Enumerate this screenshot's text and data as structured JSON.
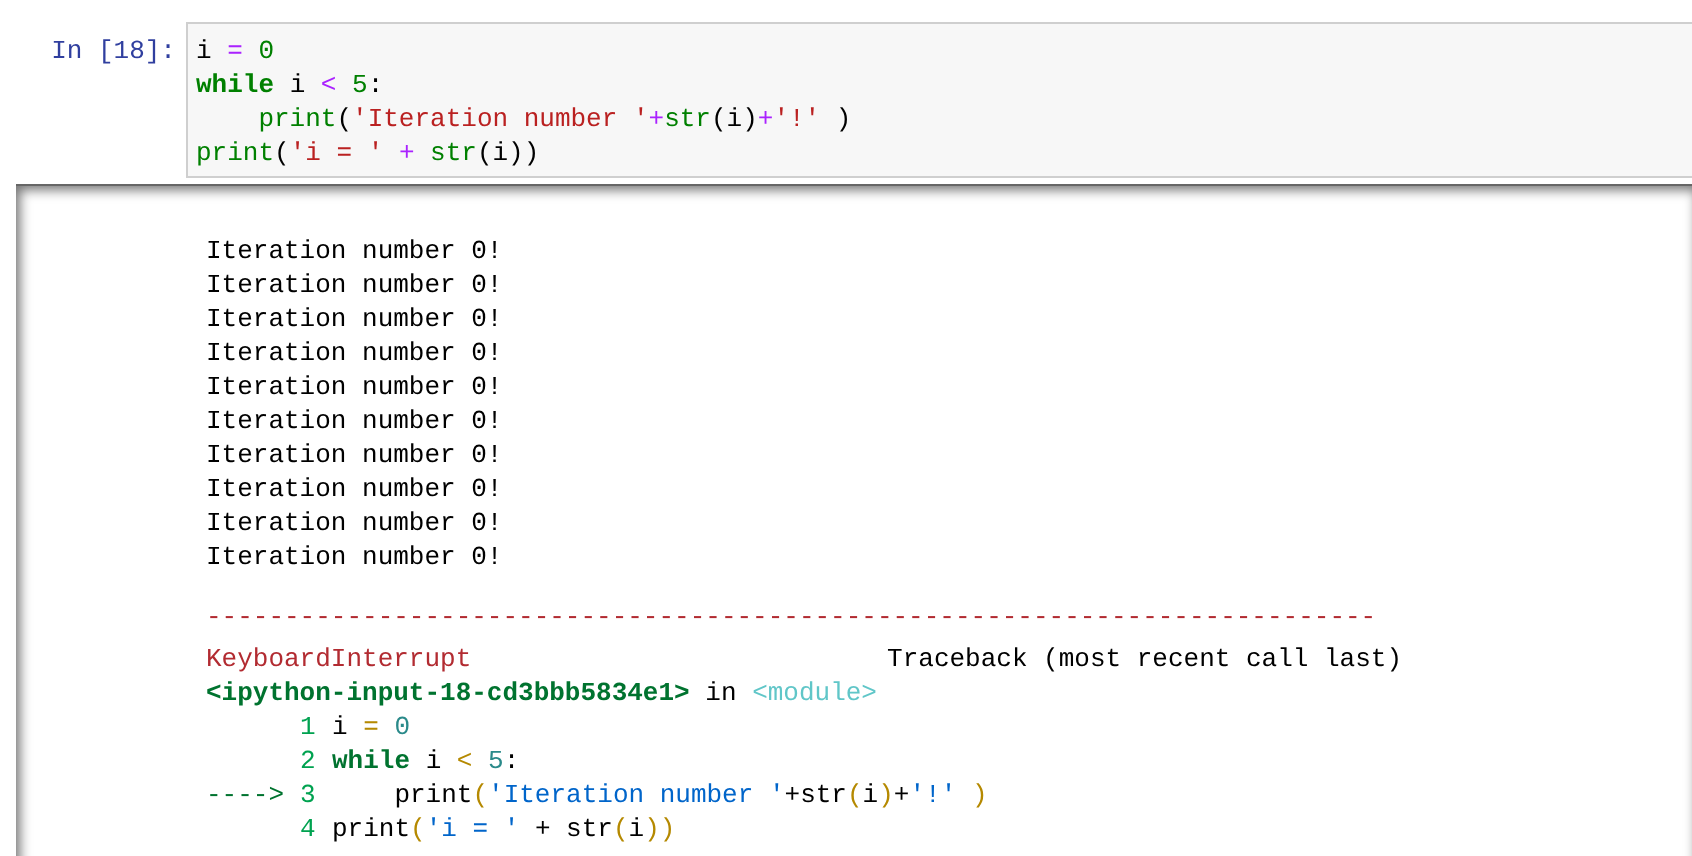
{
  "cell": {
    "prompt": "In [18]:",
    "code": [
      [
        {
          "kind": "name",
          "text": "i "
        },
        {
          "kind": "op",
          "text": "= "
        },
        {
          "kind": "number",
          "text": "0"
        }
      ],
      [
        {
          "kind": "keyword",
          "text": "while"
        },
        {
          "kind": "name",
          "text": " i "
        },
        {
          "kind": "op",
          "text": "< "
        },
        {
          "kind": "number",
          "text": "5"
        },
        {
          "kind": "name",
          "text": ":"
        }
      ],
      [
        {
          "kind": "builtin",
          "text": "    print"
        },
        {
          "kind": "name",
          "text": "("
        },
        {
          "kind": "string",
          "text": "'Iteration number '"
        },
        {
          "kind": "op",
          "text": "+"
        },
        {
          "kind": "builtin",
          "text": "str"
        },
        {
          "kind": "name",
          "text": "(i)"
        },
        {
          "kind": "op",
          "text": "+"
        },
        {
          "kind": "string",
          "text": "'!'"
        },
        {
          "kind": "name",
          "text": " )"
        }
      ],
      [
        {
          "kind": "builtin",
          "text": "print"
        },
        {
          "kind": "name",
          "text": "("
        },
        {
          "kind": "string",
          "text": "'i = '"
        },
        {
          "kind": "op",
          "text": " + "
        },
        {
          "kind": "builtin",
          "text": "str"
        },
        {
          "kind": "name",
          "text": "(i))"
        }
      ]
    ]
  },
  "output": {
    "lines": [
      "Iteration number 0!",
      "Iteration number 0!",
      "Iteration number 0!",
      "Iteration number 0!",
      "Iteration number 0!",
      "Iteration number 0!",
      "Iteration number 0!",
      "Iteration number 0!",
      "Iteration number 0!",
      "Iteration number 0!"
    ],
    "traceback": {
      "rule": "---------------------------------------------------------------------------",
      "error": "KeyboardInterrupt",
      "header": "Traceback (most recent call last)",
      "location": {
        "file": "<ipython-input-18-cd3bbb5834e1>",
        "in": "in",
        "module": "<module>"
      },
      "lines": [
        {
          "number": "1",
          "tokens": [
            {
              "kind": "name",
              "text": "i "
            },
            {
              "kind": "op",
              "text": "= "
            },
            {
              "kind": "number",
              "text": "0"
            }
          ]
        },
        {
          "number": "2",
          "tokens": [
            {
              "kind": "keyword",
              "text": "while"
            },
            {
              "kind": "name",
              "text": " i "
            },
            {
              "kind": "op",
              "text": "< "
            },
            {
              "kind": "number",
              "text": "5"
            },
            {
              "kind": "name",
              "text": ":"
            }
          ]
        },
        {
          "arrow": "---->",
          "number": "3",
          "tokens": [
            {
              "kind": "name",
              "text": "    print"
            },
            {
              "kind": "op",
              "text": "("
            },
            {
              "kind": "string",
              "text": "'Iteration number '"
            },
            {
              "kind": "name",
              "text": "+str"
            },
            {
              "kind": "op",
              "text": "("
            },
            {
              "kind": "name",
              "text": "i"
            },
            {
              "kind": "op",
              "text": ")"
            },
            {
              "kind": "name",
              "text": "+"
            },
            {
              "kind": "string",
              "text": "'!'"
            },
            {
              "kind": "op",
              "text": " )"
            }
          ]
        },
        {
          "number": "4",
          "tokens": [
            {
              "kind": "name",
              "text": "print"
            },
            {
              "kind": "op",
              "text": "("
            },
            {
              "kind": "string",
              "text": "'i = '"
            },
            {
              "kind": "name",
              "text": " + str"
            },
            {
              "kind": "op",
              "text": "("
            },
            {
              "kind": "name",
              "text": "i"
            },
            {
              "kind": "op",
              "text": "))"
            }
          ]
        }
      ]
    }
  }
}
